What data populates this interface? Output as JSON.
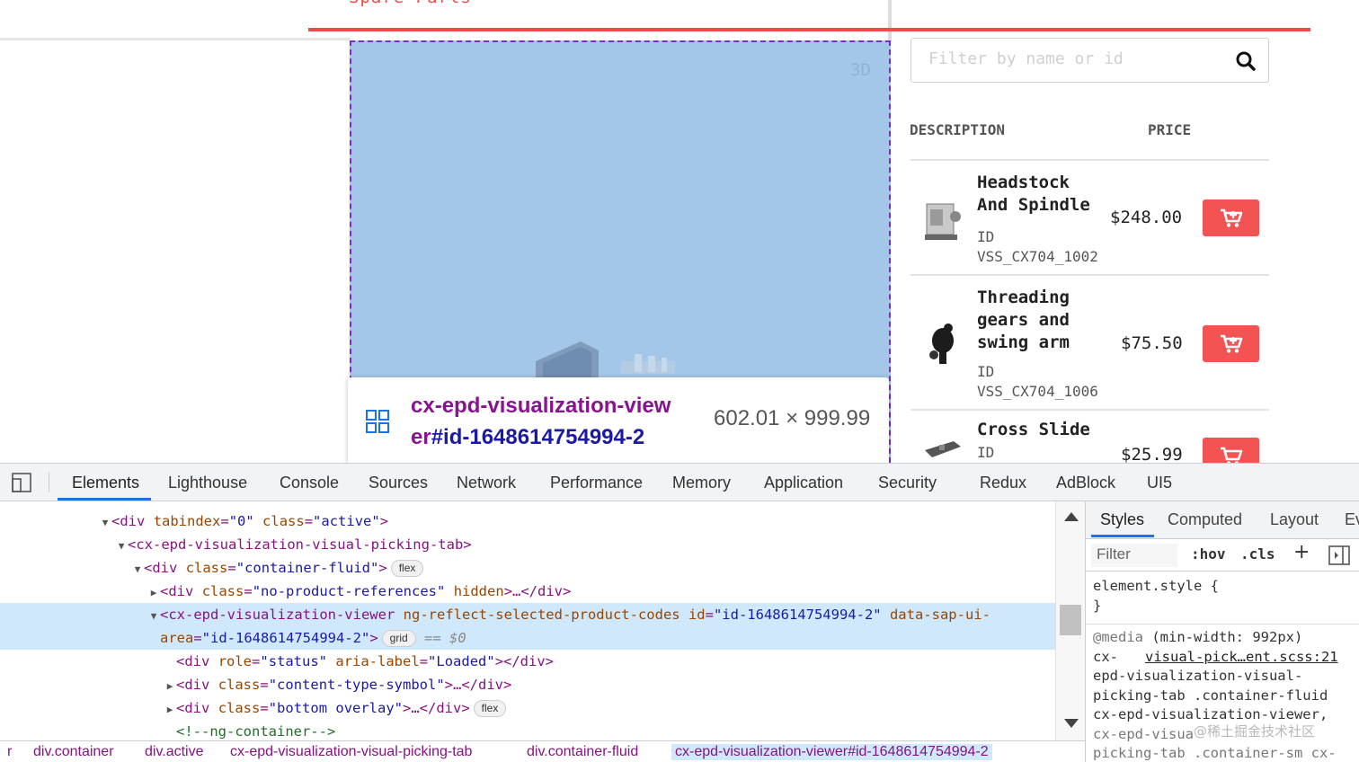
{
  "web": {
    "section_title": "Spare Parts",
    "viewer_badge": "3D",
    "filter_placeholder": "Filter by name or id",
    "columns": {
      "description": "DESCRIPTION",
      "price": "PRICE"
    },
    "parts": [
      {
        "name_lines": [
          "Headstock",
          "And Spindle"
        ],
        "id_label": "ID",
        "id": "VSS_CX704_1002",
        "price": "$248.00"
      },
      {
        "name_lines": [
          "Threading",
          "gears and",
          "swing arm"
        ],
        "id_label": "ID",
        "id": "VSS_CX704_1006",
        "price": "$75.50"
      },
      {
        "name_lines": [
          "Cross Slide"
        ],
        "id_label": "ID",
        "id": "",
        "price": "$25.99"
      }
    ],
    "accent_color": "#f35353"
  },
  "inspect_tooltip": {
    "element_line1": "cx-epd-visualization-view",
    "element_line2_tag": "er",
    "element_line2_id": "#id-1648614754994-2",
    "dimensions": "602.01 × 999.99"
  },
  "devtools": {
    "tabs": [
      "Elements",
      "Lighthouse",
      "Console",
      "Sources",
      "Network",
      "Performance",
      "Memory",
      "Application",
      "Security",
      "Redux",
      "AdBlock",
      "UI5"
    ],
    "active_tab": "Elements",
    "tree": {
      "l1": {
        "tag": "div",
        "a1": "tabindex",
        "v1": "\"0\"",
        "a2": "class",
        "v2": "\"active\""
      },
      "l2": {
        "tag": "cx-epd-visualization-visual-picking-tab"
      },
      "l3": {
        "tag": "div",
        "a1": "class",
        "v1": "\"container-fluid\"",
        "pill": "flex"
      },
      "l4": {
        "tag": "div",
        "a1": "class",
        "v1": "\"no-product-references\"",
        "a2": "hidden",
        "rest": ">…</div>"
      },
      "l5": {
        "tag": "cx-epd-visualization-viewer",
        "a1": "ng-reflect-selected-product-codes",
        "a2": "id",
        "v2": "\"id-1648614754994-2\"",
        "a3": "data-sap-ui-",
        "a3b": "area",
        "v3": "\"id-1648614754994-2\"",
        "pill": "grid",
        "eq": "== $0"
      },
      "l6": {
        "tag": "div",
        "a1": "role",
        "v1": "\"status\"",
        "a2": "aria-label",
        "v2": "\"Loaded\"",
        "rest": "></div>"
      },
      "l7": {
        "tag": "div",
        "a1": "class",
        "v1": "\"content-type-symbol\"",
        "rest": ">…</div>"
      },
      "l8": {
        "tag": "div",
        "a1": "class",
        "v1": "\"bottom overlay\"",
        "rest": ">…</div>",
        "pill": "flex"
      },
      "l9": {
        "comment": "<!--ng-container-->"
      }
    },
    "breadcrumbs": [
      "r",
      "div.container",
      "div.active",
      "cx-epd-visualization-visual-picking-tab",
      "div.container-fluid",
      "cx-epd-visualization-viewer#id-1648614754994-2"
    ],
    "styles": {
      "tabs": [
        "Styles",
        "Computed",
        "Layout",
        "Ev"
      ],
      "filter_placeholder": "Filter",
      "hov": ":hov",
      "cls": ".cls",
      "element_style": "element.style {",
      "close_brace": "}",
      "media": "@media",
      "media_query": "(min-width: 992px)",
      "selector_l1": "cx-",
      "source_link": "visual-pick…ent.scss:21",
      "selector_l2": "epd-visualization-visual-",
      "selector_l3": "picking-tab .container-fluid",
      "selector_l4": "cx-epd-visualization-viewer,",
      "selector_l5": "cx-epd-visua",
      "selector_l6": "picking-tab .container-sm cx-"
    }
  },
  "watermark": "@稀土掘金技术社区"
}
